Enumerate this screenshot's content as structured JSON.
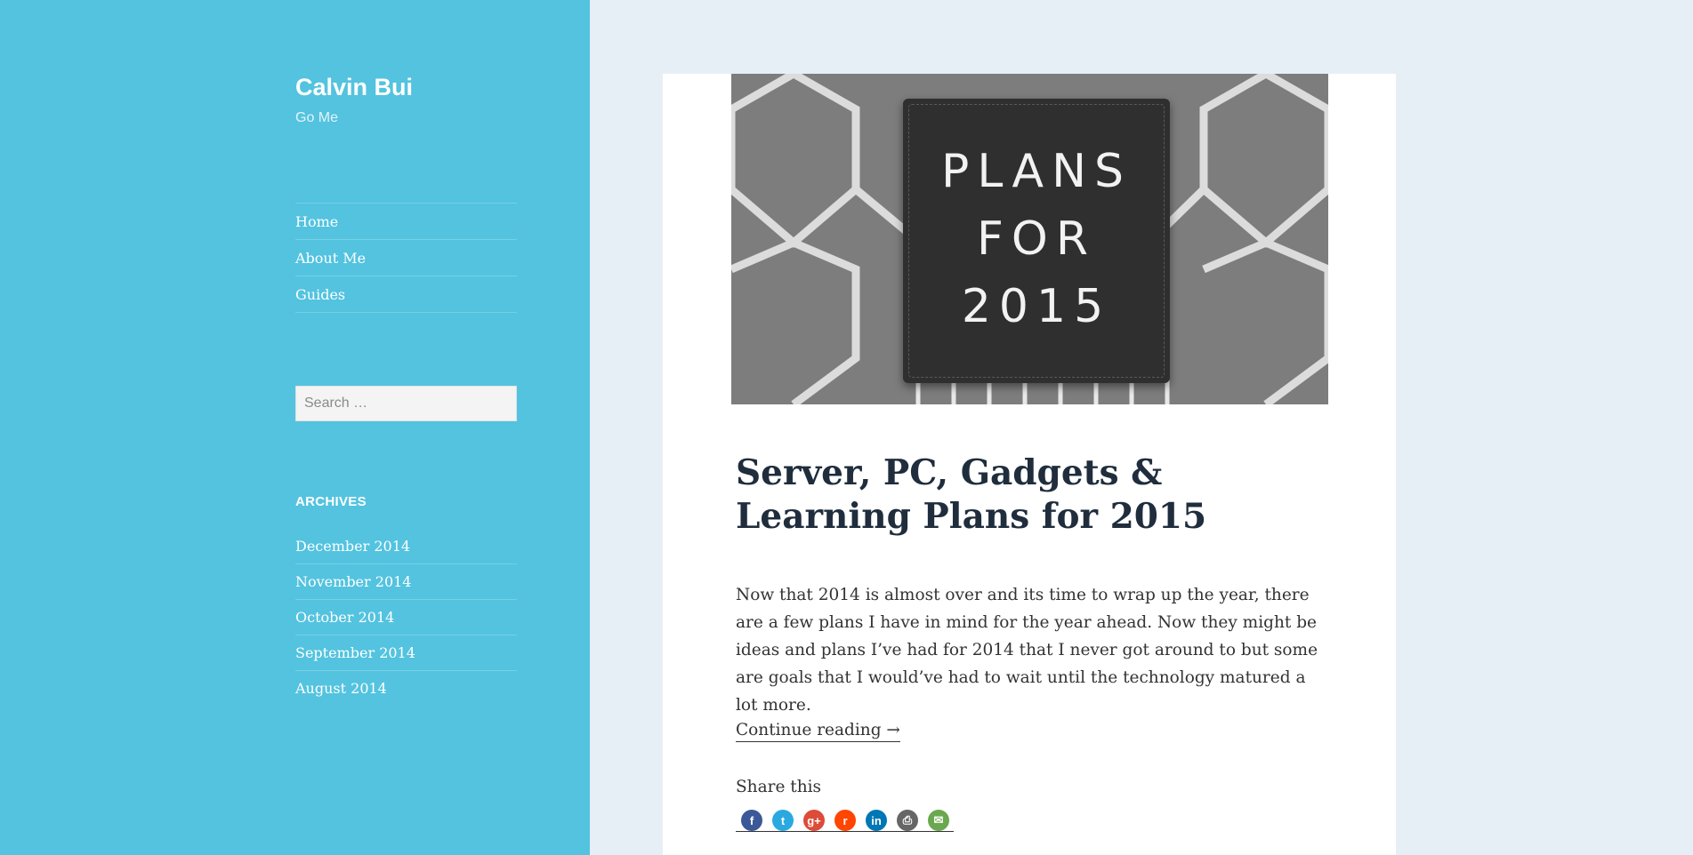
{
  "site": {
    "title": "Calvin Bui",
    "tagline": "Go Me"
  },
  "nav": {
    "items": [
      {
        "label": "Home"
      },
      {
        "label": "About Me"
      },
      {
        "label": "Guides"
      }
    ]
  },
  "search": {
    "placeholder": "Search …"
  },
  "archives": {
    "title": "ARCHIVES",
    "items": [
      {
        "label": "December 2014"
      },
      {
        "label": "November 2014"
      },
      {
        "label": "October 2014"
      },
      {
        "label": "September 2014"
      },
      {
        "label": "August 2014"
      }
    ]
  },
  "post": {
    "image_text": [
      "PLANS",
      "FOR",
      "2015"
    ],
    "title": "Server, PC, Gadgets & Learning Plans for 2015",
    "excerpt": "Now that 2014 is almost over and its time to wrap up the year, there are a few plans I have in mind for the year ahead. Now they might be ideas and plans I’ve had for 2014 that I never got around to but some are goals that I would’ve had to wait until the technology matured a lot more.",
    "continue_label": "Continue reading →",
    "share_title": "Share this",
    "share_icons": [
      {
        "name": "facebook-icon",
        "glyph": "f",
        "color": "#3b5998"
      },
      {
        "name": "twitter-icon",
        "glyph": "t",
        "color": "#2aa9e0"
      },
      {
        "name": "google-plus-icon",
        "glyph": "g+",
        "color": "#dd4b39"
      },
      {
        "name": "reddit-icon",
        "glyph": "r",
        "color": "#ff4500"
      },
      {
        "name": "linkedin-icon",
        "glyph": "in",
        "color": "#0077b5"
      },
      {
        "name": "print-icon",
        "glyph": "⎙",
        "color": "#666666"
      },
      {
        "name": "email-icon",
        "glyph": "✉",
        "color": "#6aa84f"
      }
    ]
  },
  "colors": {
    "sidebar": "#53c3df",
    "page_bg": "#e7eff6",
    "card_bg": "#ffffff",
    "title_text": "#1f2d3d"
  }
}
